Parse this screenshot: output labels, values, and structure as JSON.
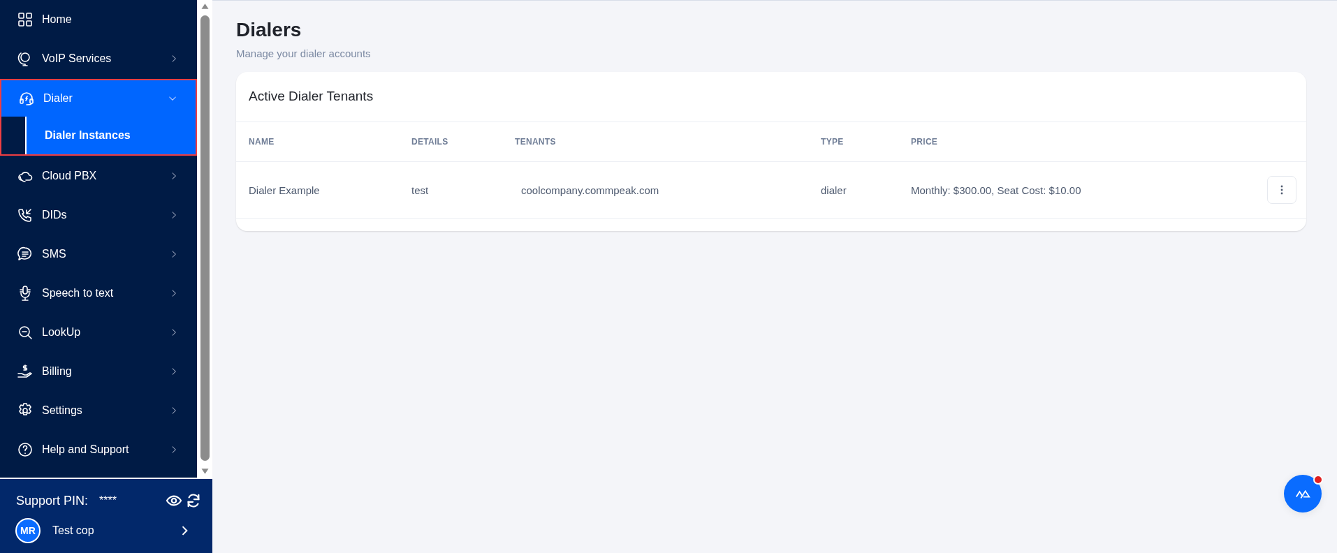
{
  "sidebar": {
    "items": [
      {
        "label": "Home",
        "expandable": false,
        "selected": false
      },
      {
        "label": "VoIP Services",
        "expandable": true,
        "expanded": false,
        "selected": false
      },
      {
        "label": "Dialer",
        "expandable": true,
        "expanded": true,
        "selected": true,
        "children": [
          {
            "label": "Dialer Instances",
            "selected": true
          }
        ]
      },
      {
        "label": "Cloud PBX",
        "expandable": true,
        "expanded": false,
        "selected": false
      },
      {
        "label": "DIDs",
        "expandable": true,
        "expanded": false,
        "selected": false
      },
      {
        "label": "SMS",
        "expandable": true,
        "expanded": false,
        "selected": false
      },
      {
        "label": "Speech to text",
        "expandable": true,
        "expanded": false,
        "selected": false
      },
      {
        "label": "LookUp",
        "expandable": true,
        "expanded": false,
        "selected": false
      },
      {
        "label": "Billing",
        "expandable": true,
        "expanded": false,
        "selected": false
      },
      {
        "label": "Settings",
        "expandable": true,
        "expanded": false,
        "selected": false
      },
      {
        "label": "Help and Support",
        "expandable": true,
        "expanded": false,
        "selected": false
      }
    ]
  },
  "support_pin": {
    "label": "Support PIN:",
    "value": "****"
  },
  "user": {
    "initials": "MR",
    "name": "Test cop"
  },
  "page": {
    "title": "Dialers",
    "subtitle": "Manage your dialer accounts"
  },
  "card": {
    "title": "Active Dialer Tenants",
    "table": {
      "columns": [
        "NAME",
        "DETAILS",
        "TENANTS",
        "TYPE",
        "PRICE"
      ],
      "rows": [
        [
          "Dialer Example",
          "test",
          "coolcompany.commpeak.com",
          "dialer",
          "Monthly: $300.00, Seat Cost: $10.00"
        ]
      ]
    }
  },
  "chat_button": {
    "notification": true
  }
}
